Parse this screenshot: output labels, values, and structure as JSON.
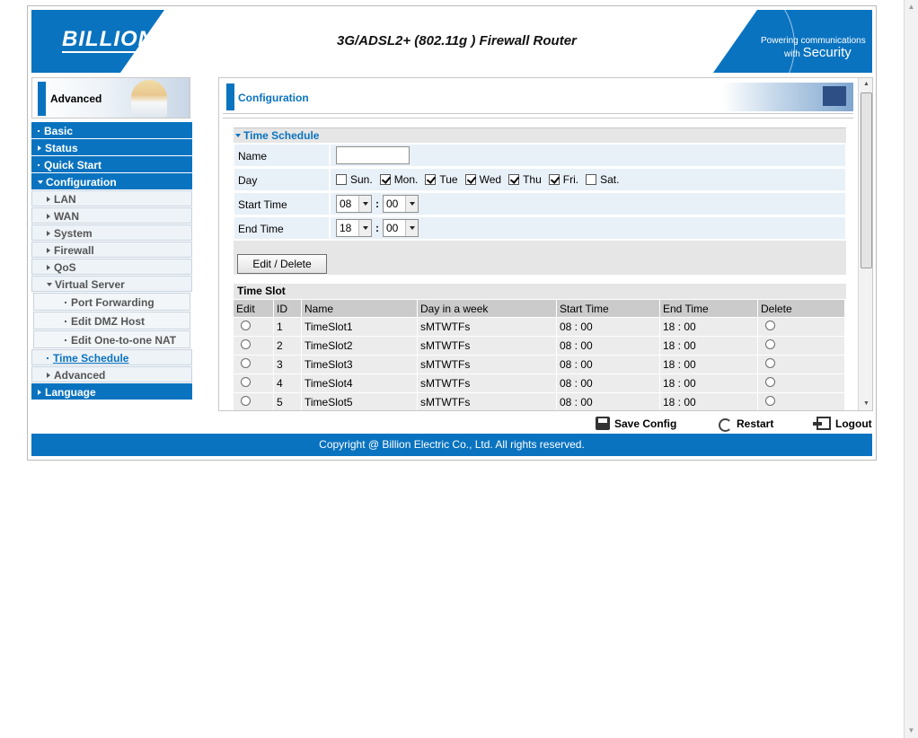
{
  "header": {
    "brand": "BILLION",
    "product_title": "3G/ADSL2+ (802.11g ) Firewall Router",
    "tagline_line1": "Powering communications",
    "tagline_line2_small": "with",
    "tagline_line2_big": "Security"
  },
  "sidebar": {
    "mode_label": "Advanced",
    "items": [
      {
        "label": "Basic"
      },
      {
        "label": "Status"
      },
      {
        "label": "Quick Start"
      },
      {
        "label": "Configuration"
      },
      {
        "label": "LAN"
      },
      {
        "label": "WAN"
      },
      {
        "label": "System"
      },
      {
        "label": "Firewall"
      },
      {
        "label": "QoS"
      },
      {
        "label": "Virtual Server"
      },
      {
        "label": "Port Forwarding"
      },
      {
        "label": "Edit DMZ Host"
      },
      {
        "label": "Edit One-to-one NAT"
      },
      {
        "label": "Time Schedule"
      },
      {
        "label": "Advanced"
      },
      {
        "label": "Language"
      }
    ]
  },
  "main": {
    "heading": "Configuration",
    "section_title": "Time Schedule",
    "name_label": "Name",
    "name_value": "",
    "day_label": "Day",
    "days": [
      {
        "label": "Sun.",
        "checked": false
      },
      {
        "label": "Mon.",
        "checked": true
      },
      {
        "label": "Tue",
        "checked": true
      },
      {
        "label": "Wed",
        "checked": true
      },
      {
        "label": "Thu",
        "checked": true
      },
      {
        "label": "Fri.",
        "checked": true
      },
      {
        "label": "Sat.",
        "checked": false
      }
    ],
    "start_time_label": "Start Time",
    "start_hour": "08",
    "start_min": "00",
    "end_time_label": "End Time",
    "end_hour": "18",
    "end_min": "00",
    "time_separator": ":",
    "edit_button": "Edit / Delete",
    "slot_title": "Time Slot",
    "table": {
      "columns": [
        "Edit",
        "ID",
        "Name",
        "Day in a week",
        "Start Time",
        "End Time",
        "Delete"
      ],
      "rows": [
        {
          "id": "1",
          "name": "TimeSlot1",
          "days": "sMTWTFs",
          "start": "08 : 00",
          "end": "18 : 00"
        },
        {
          "id": "2",
          "name": "TimeSlot2",
          "days": "sMTWTFs",
          "start": "08 : 00",
          "end": "18 : 00"
        },
        {
          "id": "3",
          "name": "TimeSlot3",
          "days": "sMTWTFs",
          "start": "08 : 00",
          "end": "18 : 00"
        },
        {
          "id": "4",
          "name": "TimeSlot4",
          "days": "sMTWTFs",
          "start": "08 : 00",
          "end": "18 : 00"
        },
        {
          "id": "5",
          "name": "TimeSlot5",
          "days": "sMTWTFs",
          "start": "08 : 00",
          "end": "18 : 00"
        }
      ]
    }
  },
  "toolbar": {
    "save_label": "Save Config",
    "restart_label": "Restart",
    "logout_label": "Logout"
  },
  "footer": {
    "copyright": "Copyright @ Billion Electric Co., Ltd. All rights reserved."
  },
  "colors": {
    "brand_blue": "#0a73c0",
    "row_light": "#e8f0f8",
    "header_gray": "#cbcbcb"
  }
}
